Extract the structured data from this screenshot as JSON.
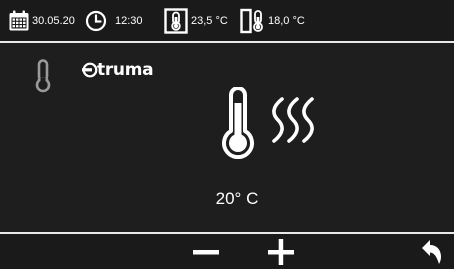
{
  "status_bar": {
    "date": "30.05.20",
    "time": "12:30",
    "inside_temp": "23,5 °C",
    "outside_temp": "18,0 °C"
  },
  "main": {
    "brand": "truma",
    "set_temperature": "20° C",
    "mode_icon": "thermometer-icon",
    "heat_icon": "thermometer-heat-waves-icon"
  },
  "bottom_bar": {
    "minus_icon": "minus-icon",
    "plus_icon": "plus-icon",
    "back_icon": "back-arrow-icon"
  },
  "colors": {
    "background": "#1e1e1e",
    "bar_background": "#1a1a1a",
    "separator": "#e9e9e9",
    "foreground": "#ffffff",
    "mode_icon": "#9a9a9a"
  }
}
